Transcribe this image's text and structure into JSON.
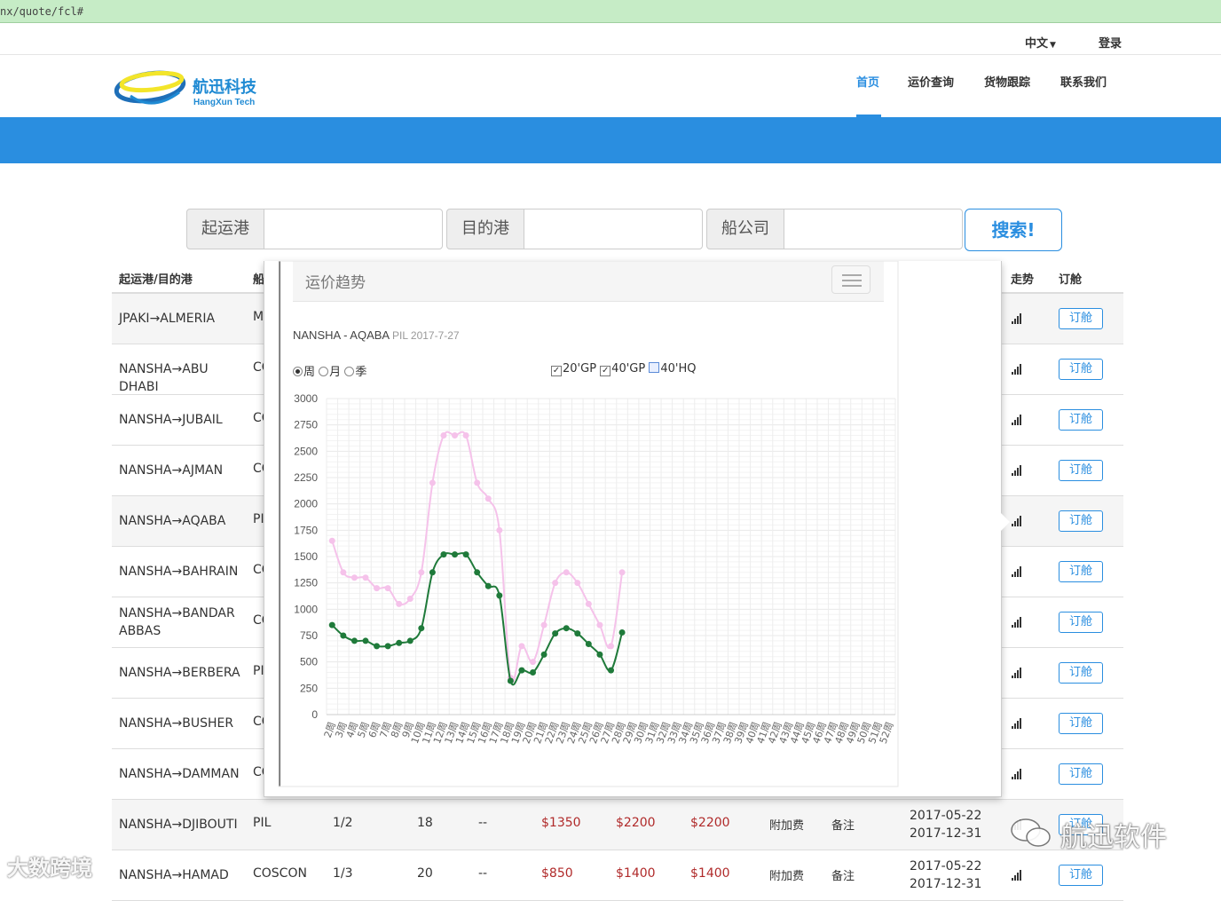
{
  "browser": {
    "url": "nx/quote/fcl#"
  },
  "topbar": {
    "language": "中文",
    "login": "登录"
  },
  "logo": {
    "cn": "航迅科技",
    "en": "HangXun Tech"
  },
  "nav": [
    {
      "label": "首页",
      "active": true
    },
    {
      "label": "运价查询",
      "active": false
    },
    {
      "label": "货物跟踪",
      "active": false
    },
    {
      "label": "联系我们",
      "active": false
    }
  ],
  "search": {
    "origin_label": "起运港",
    "dest_label": "目的港",
    "carrier_label": "船公司",
    "button": "搜索!"
  },
  "table": {
    "headers": {
      "route": "起运港/目的港",
      "carrier": "船",
      "trend": "走势",
      "book": "订舱"
    },
    "book_label": "订舱",
    "rows": [
      {
        "route": "JPAKI→ALMERIA",
        "carrier": "M"
      },
      {
        "route": "NANSHA→ABU DHABI",
        "carrier": "CO"
      },
      {
        "route": "NANSHA→JUBAIL",
        "carrier": "CO"
      },
      {
        "route": "NANSHA→AJMAN",
        "carrier": "CO"
      },
      {
        "route": "NANSHA→AQABA",
        "carrier": "PI"
      },
      {
        "route": "NANSHA→BAHRAIN",
        "carrier": "CO"
      },
      {
        "route": "NANSHA→BANDAR ABBAS",
        "carrier": "CO"
      },
      {
        "route": "NANSHA→BERBERA",
        "carrier": "PI"
      },
      {
        "route": "NANSHA→BUSHER",
        "carrier": "CO"
      },
      {
        "route": "NANSHA→DAMMAN",
        "carrier": "CO"
      },
      {
        "route": "NANSHA→DJIBOUTI",
        "carrier": "PIL",
        "freq": "1/2",
        "days": "18",
        "transit": "--",
        "p20": "$1350",
        "p40": "$2200",
        "p40hq": "$2200",
        "surcharge": "附加费",
        "remark": "备注",
        "valid_from": "2017-05-22",
        "valid_to": "2017-12-31"
      },
      {
        "route": "NANSHA→HAMAD",
        "carrier": "COSCON",
        "freq": "1/3",
        "days": "20",
        "transit": "--",
        "p20": "$850",
        "p40": "$1400",
        "p40hq": "$1400",
        "surcharge": "附加费",
        "remark": "备注",
        "valid_from": "2017-05-22",
        "valid_to": "2017-12-31"
      }
    ]
  },
  "popover": {
    "title": "运价趋势",
    "route": "NANSHA - AQABA",
    "meta": "PIL 2017-7-27",
    "period_options": [
      "周",
      "月",
      "季"
    ],
    "period_selected": "周",
    "container_options": [
      {
        "label": "20'GP",
        "checked": true
      },
      {
        "label": "40'GP",
        "checked": true
      },
      {
        "label": "40'HQ",
        "checked": false
      }
    ]
  },
  "chart_data": {
    "type": "line",
    "ylim": [
      0,
      3000
    ],
    "yticks": [
      0,
      250,
      500,
      750,
      1000,
      1250,
      1500,
      1750,
      2000,
      2250,
      2500,
      2750,
      3000
    ],
    "categories": [
      "2周",
      "3周",
      "4周",
      "5周",
      "6周",
      "7周",
      "8周",
      "9周",
      "10周",
      "11周",
      "12周",
      "13周",
      "14周",
      "15周",
      "16周",
      "17周",
      "18周",
      "19周",
      "20周",
      "21周",
      "22周",
      "23周",
      "24周",
      "25周",
      "26周",
      "27周",
      "28周",
      "29周",
      "30周",
      "31周",
      "32周",
      "33周",
      "34周",
      "35周",
      "36周",
      "37周",
      "38周",
      "39周",
      "40周",
      "41周",
      "42周",
      "43周",
      "44周",
      "45周",
      "46周",
      "47周",
      "48周",
      "49周",
      "50周",
      "51周",
      "52周"
    ],
    "series": [
      {
        "color": "#f5c2ea",
        "values": [
          1650,
          1350,
          1300,
          1300,
          1200,
          1200,
          1050,
          1100,
          1350,
          2200,
          2650,
          2650,
          2650,
          2200,
          2050,
          1750,
          350,
          650,
          500,
          850,
          1250,
          1350,
          1250,
          1050,
          850,
          650,
          1350
        ]
      },
      {
        "color": "#1f7a3a",
        "values": [
          850,
          750,
          700,
          700,
          650,
          650,
          680,
          700,
          820,
          1350,
          1520,
          1520,
          1520,
          1350,
          1220,
          1130,
          320,
          420,
          400,
          570,
          770,
          820,
          770,
          670,
          570,
          420,
          780
        ]
      }
    ]
  },
  "watermarks": {
    "left": "大数跨境",
    "right": "航迅软件"
  }
}
